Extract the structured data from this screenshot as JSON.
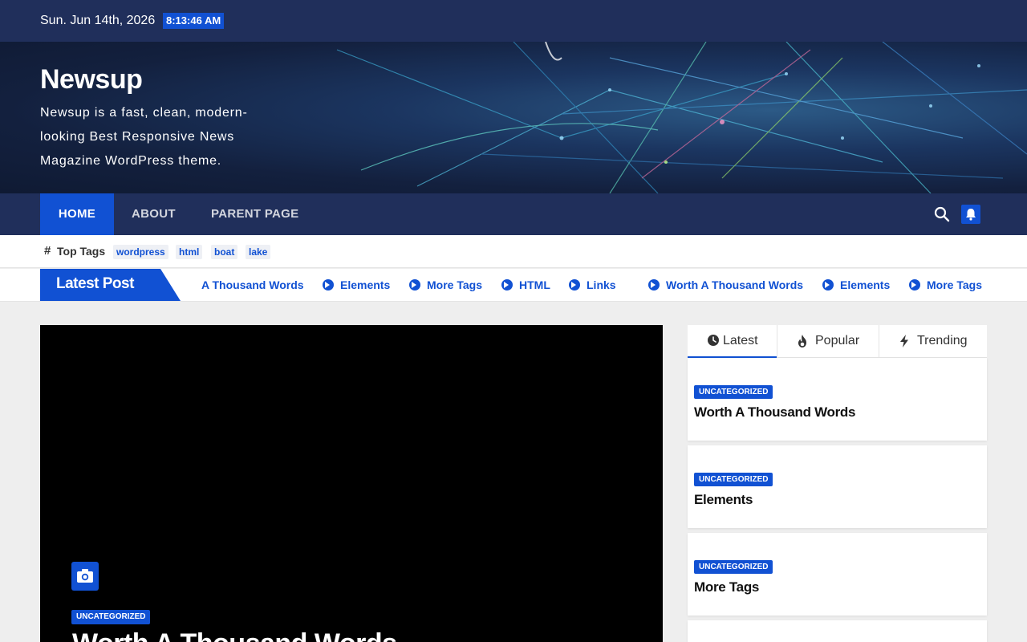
{
  "topbar": {
    "date": "Sun. Jun 14th, 2026",
    "time": "8:13:46 AM"
  },
  "header": {
    "title": "Newsup",
    "description": "Newsup is a fast, clean, modern-looking Best Responsive News Magazine WordPress theme."
  },
  "nav": {
    "items": [
      {
        "label": "HOME",
        "active": true
      },
      {
        "label": "ABOUT",
        "active": false
      },
      {
        "label": "PARENT PAGE",
        "active": false
      }
    ],
    "icons": [
      "search-icon",
      "bell-icon"
    ]
  },
  "top_tags": {
    "hash": "#",
    "label": "Top Tags",
    "tags": [
      "wordpress",
      "html",
      "boat",
      "lake"
    ]
  },
  "ticker": {
    "label": "Latest Post",
    "items": [
      "A Thousand Words",
      "Elements",
      "More Tags",
      "HTML",
      "Links",
      "Worth A Thousand Words",
      "Elements",
      "More Tags"
    ]
  },
  "featured": {
    "category": "UNCATEGORIZED",
    "title": "Worth A Thousand Words",
    "icon": "camera-icon"
  },
  "sidebar": {
    "tabs": [
      {
        "label": "Latest",
        "icon": "clock-icon",
        "active": true
      },
      {
        "label": "Popular",
        "icon": "fire-icon",
        "active": false
      },
      {
        "label": "Trending",
        "icon": "bolt-icon",
        "active": false
      }
    ],
    "posts": [
      {
        "category": "UNCATEGORIZED",
        "title": "Worth A Thousand Words"
      },
      {
        "category": "UNCATEGORIZED",
        "title": "Elements"
      },
      {
        "category": "UNCATEGORIZED",
        "title": "More Tags"
      }
    ]
  },
  "colors": {
    "primary": "#1151d3",
    "navy": "#202f5b",
    "background": "#eeeeee"
  }
}
